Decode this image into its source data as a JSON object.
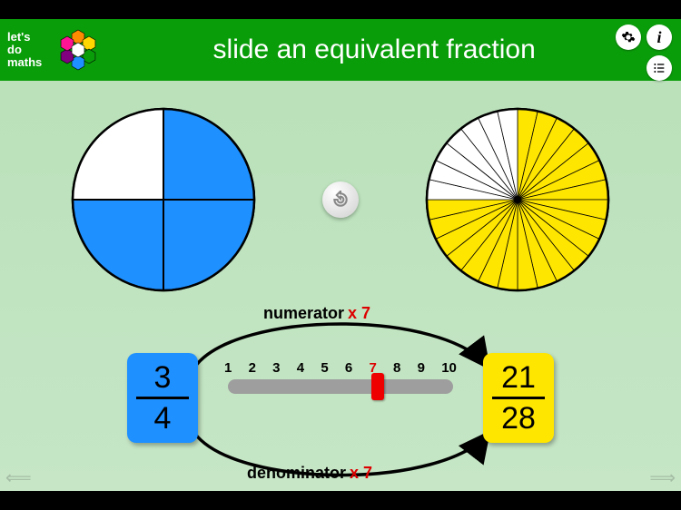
{
  "brand": {
    "line1": "let's",
    "line2": "do",
    "line3": "maths"
  },
  "title": "slide an equivalent fraction",
  "fraction": {
    "numerator": 3,
    "denominator": 4
  },
  "multiplier": 7,
  "result": {
    "numerator": 21,
    "denominator": 28
  },
  "slider": {
    "min": 1,
    "max": 10,
    "value": 7,
    "ticks": [
      1,
      2,
      3,
      4,
      5,
      6,
      7,
      8,
      9,
      10
    ]
  },
  "labels": {
    "numerator": "numerator",
    "denominator": "denominator",
    "mult_prefix": "x "
  },
  "colors": {
    "header": "#0a9d0a",
    "pie1_fill": "#1e90ff",
    "pie2_fill": "#ffe600",
    "slider_thumb": "#e00"
  },
  "logo_hex_colors": [
    "#ff8c00",
    "#ffd700",
    "#0a9d0a",
    "#1e90ff",
    "#800080",
    "#ff1493"
  ],
  "chart_data": [
    {
      "type": "pie",
      "total_slices": 4,
      "filled_slices": 3,
      "fill_color": "#1e90ff",
      "title": "3/4"
    },
    {
      "type": "pie",
      "total_slices": 28,
      "filled_slices": 21,
      "fill_color": "#ffe600",
      "title": "21/28"
    }
  ]
}
